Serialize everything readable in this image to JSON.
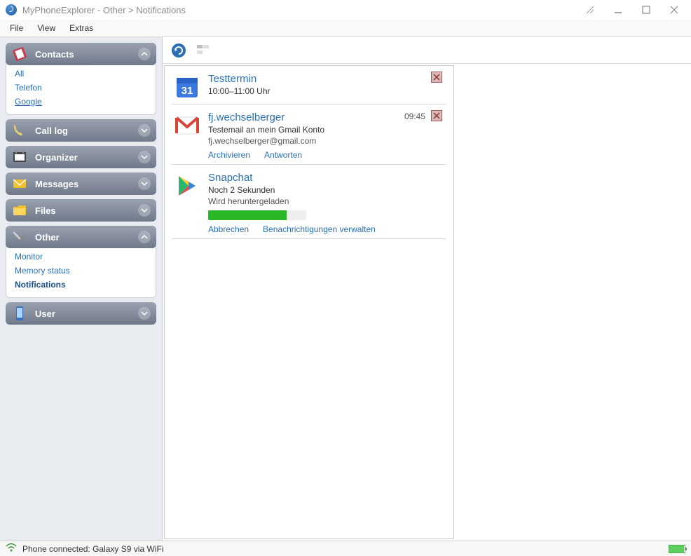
{
  "title": "MyPhoneExplorer -  Other > Notifications",
  "menu": {
    "file": "File",
    "view": "View",
    "extras": "Extras"
  },
  "sidebar": {
    "contacts": {
      "label": "Contacts",
      "items": [
        "All",
        "Telefon",
        "Google"
      ]
    },
    "calllog": {
      "label": "Call log"
    },
    "organizer": {
      "label": "Organizer"
    },
    "messages": {
      "label": "Messages"
    },
    "files": {
      "label": "Files"
    },
    "other": {
      "label": "Other",
      "items": [
        "Monitor",
        "Memory status",
        "Notifications"
      ]
    },
    "user": {
      "label": "User"
    }
  },
  "notifications": [
    {
      "id": "calendar",
      "title": "Testtermin",
      "subtitle": "10:00–11:00 Uhr",
      "time": "",
      "actions": []
    },
    {
      "id": "gmail",
      "title": "fj.wechselberger",
      "subtitle": "Testemail an mein Gmail Konto",
      "subtitle2": "fj.wechselberger@gmail.com",
      "time": "09:45",
      "actions": [
        "Archivieren",
        "Antworten"
      ]
    },
    {
      "id": "play",
      "title": "Snapchat",
      "subtitle": "Noch 2 Sekunden",
      "subtitle2": "Wird heruntergeladen",
      "progress": 80,
      "actions": [
        "Abbrechen",
        "Benachrichtigungen verwalten"
      ]
    }
  ],
  "status": {
    "text": "Phone connected: Galaxy S9 via WiFi",
    "battery_pct": 95
  }
}
